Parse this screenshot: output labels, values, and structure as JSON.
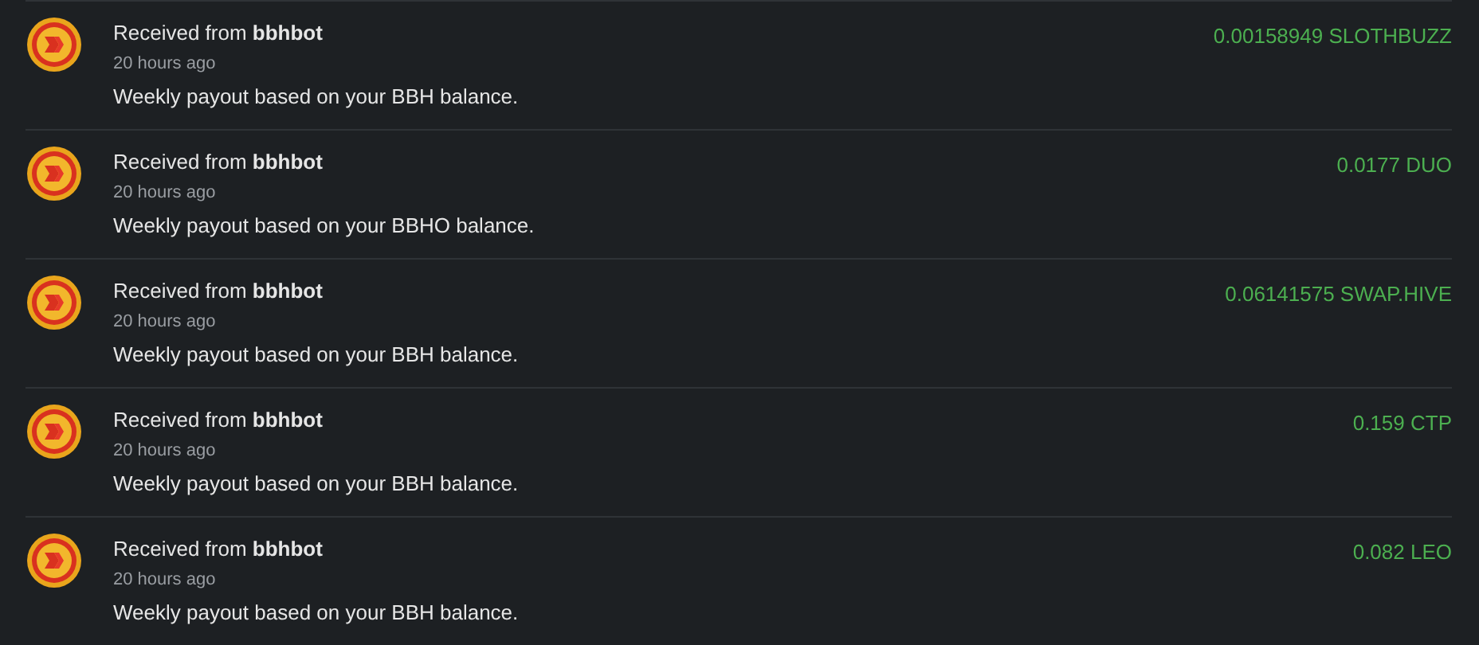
{
  "transactions": [
    {
      "title": "Received from **bbhbot**",
      "time": "20 hours ago",
      "memo": "Weekly payout based on your BBH balance.",
      "amount": "0.00158949 SLOTHBUZZ"
    },
    {
      "title": "Received from **bbhbot**",
      "time": "20 hours ago",
      "memo": "Weekly payout based on your BBHO balance.",
      "amount": "0.0177 DUO"
    },
    {
      "title": "Received from **bbhbot**",
      "time": "20 hours ago",
      "memo": "Weekly payout based on your BBH balance.",
      "amount": "0.06141575 SWAP.HIVE"
    },
    {
      "title": "Received from **bbhbot**",
      "time": "20 hours ago",
      "memo": "Weekly payout based on your BBH balance.",
      "amount": "0.159 CTP"
    },
    {
      "title": "Received from **bbhbot**",
      "time": "20 hours ago",
      "memo": "Weekly payout based on your BBH balance.",
      "amount": "0.082 LEO"
    }
  ]
}
